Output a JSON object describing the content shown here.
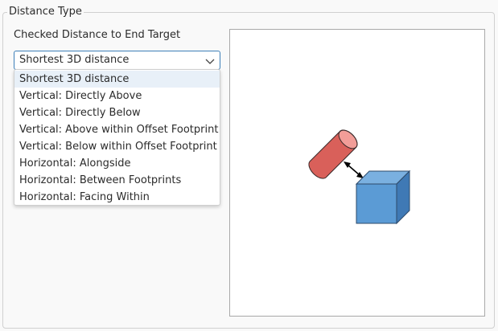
{
  "group": {
    "title": "Distance Type"
  },
  "field": {
    "label": "Checked Distance to End Target"
  },
  "combo": {
    "value": "Shortest 3D distance",
    "icon": "chevron-down-icon",
    "options": [
      "Shortest 3D distance",
      "Vertical: Directly Above",
      "Vertical: Directly Below",
      "Vertical: Above within Offset Footprint",
      "Vertical: Below within Offset Footprint",
      "Horizontal: Alongside",
      "Horizontal: Between Footprints",
      "Horizontal: Facing Within"
    ],
    "selected_index": 0
  },
  "colors": {
    "accent_border": "#3d7fb8",
    "highlight": "#e8f0f8",
    "cylinder": "#d9605a",
    "cube": "#5b9bd5"
  }
}
